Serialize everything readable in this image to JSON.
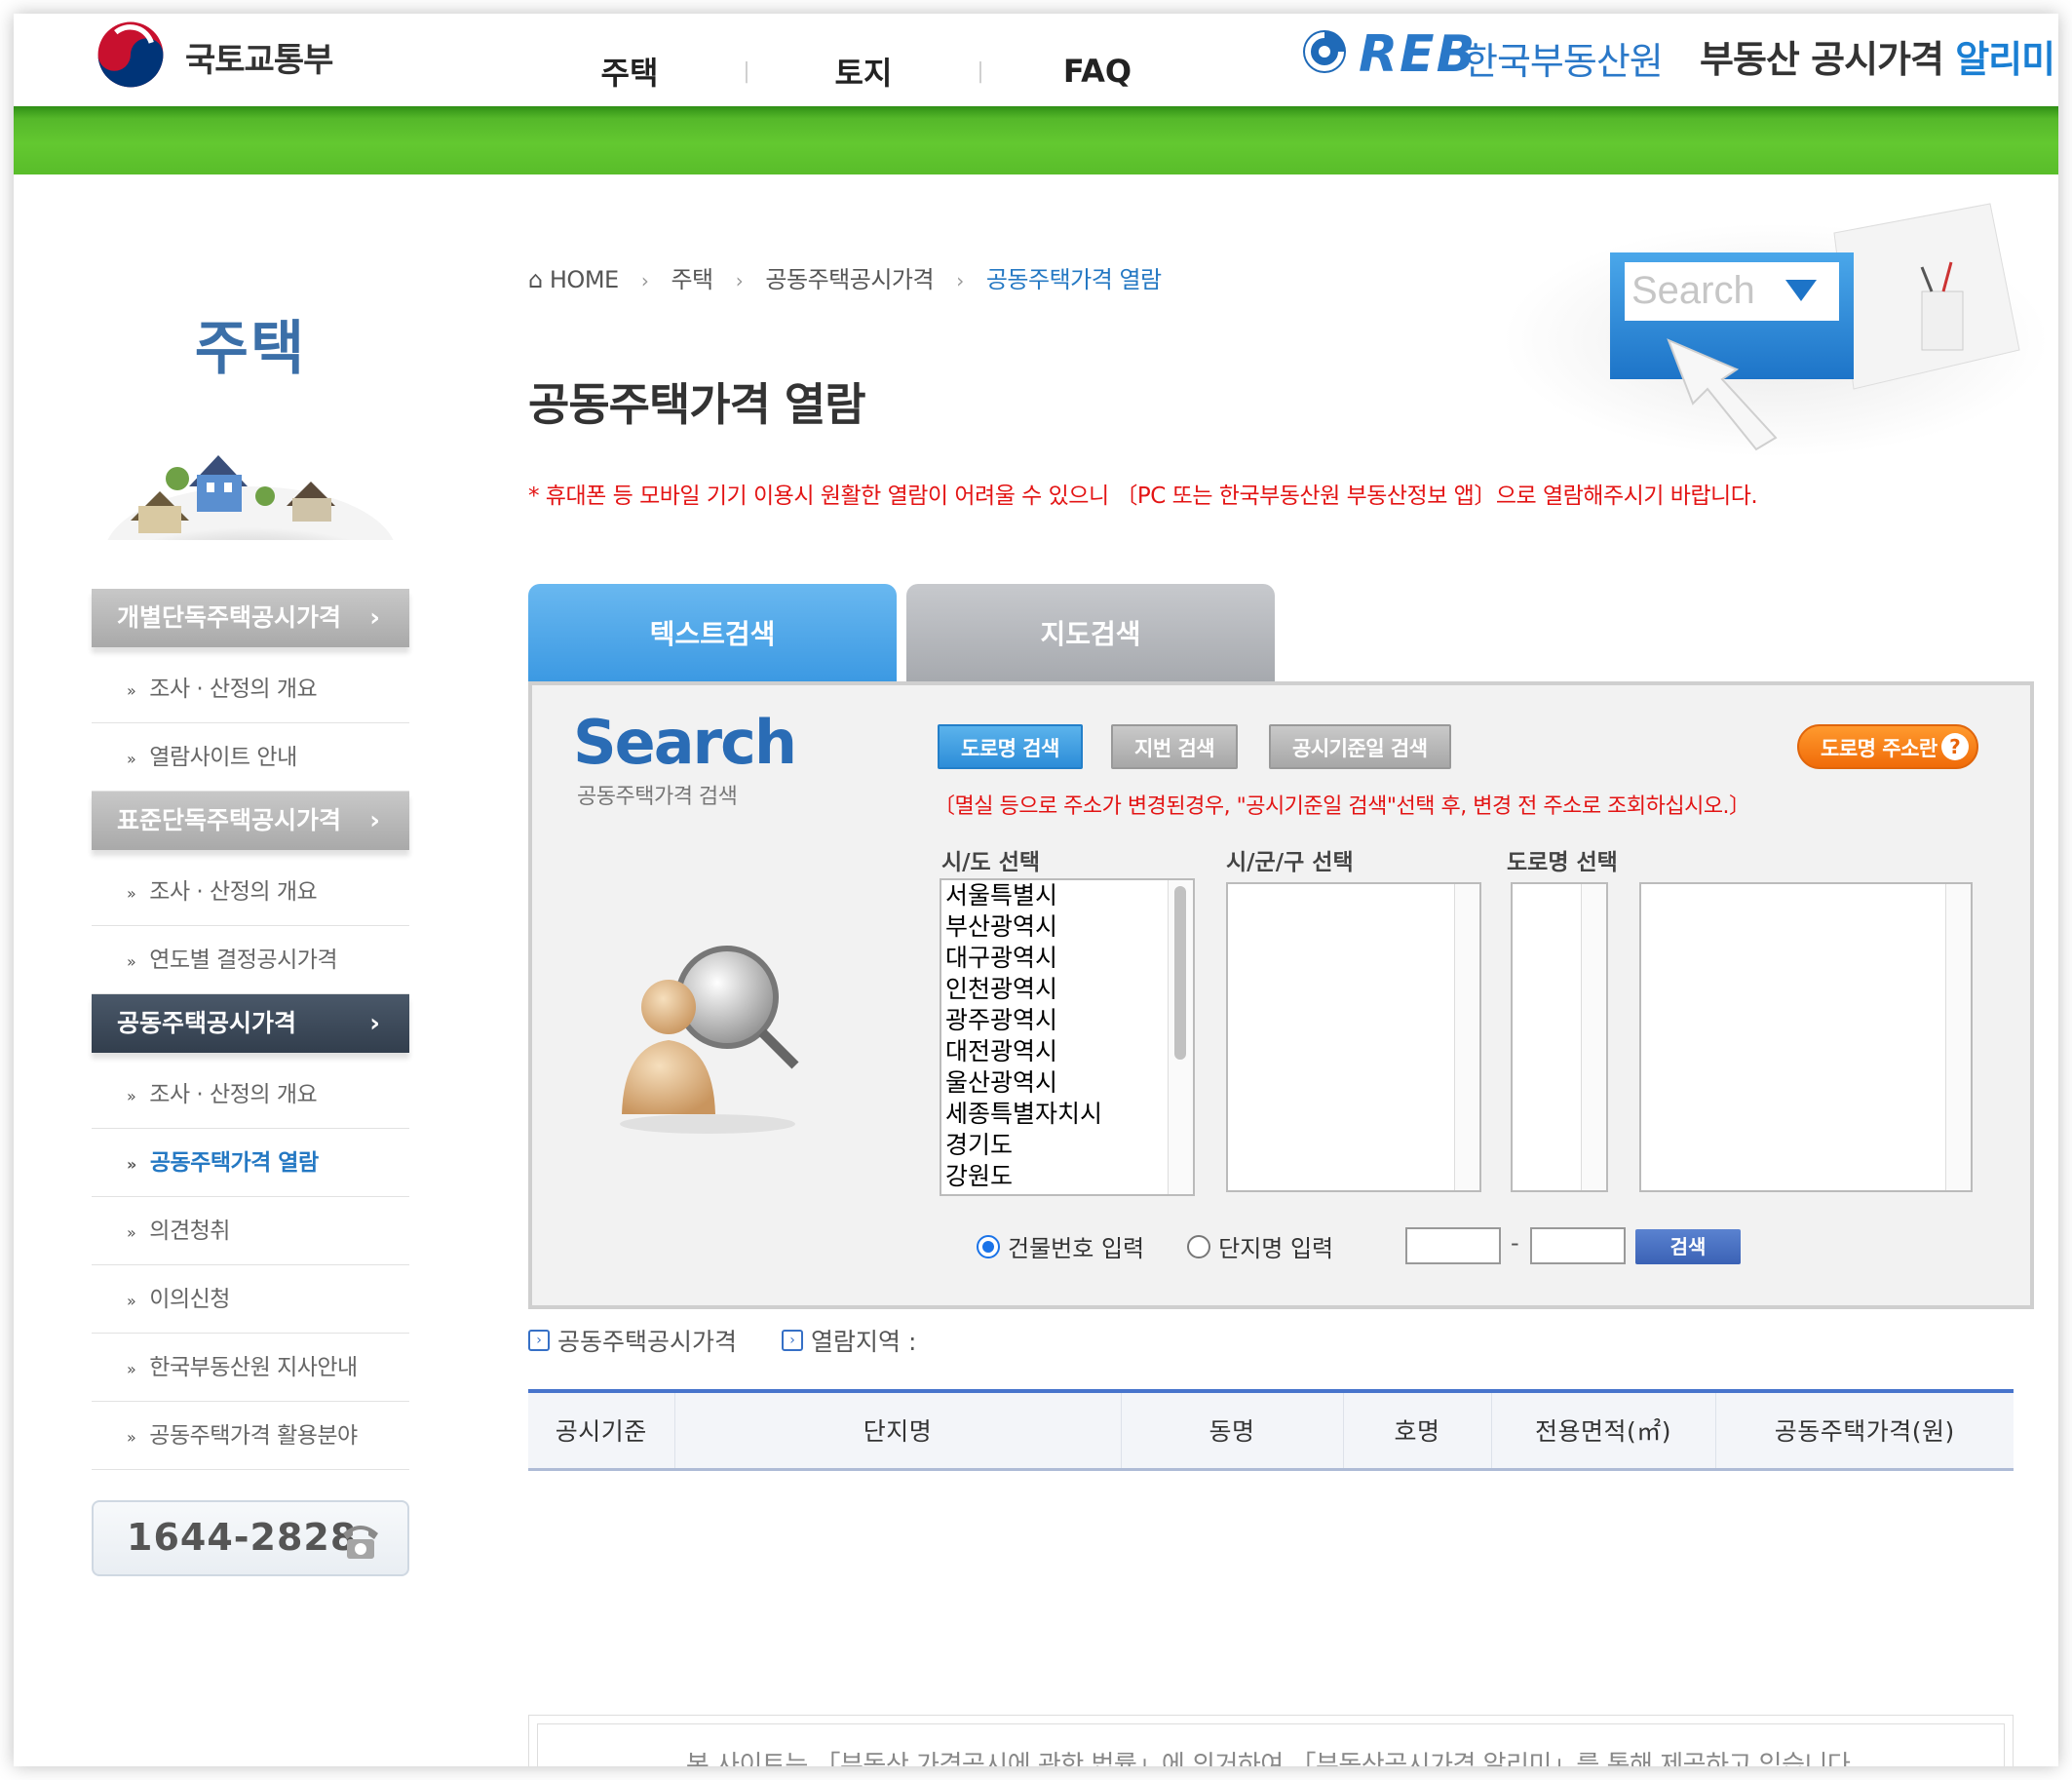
{
  "header": {
    "gov_name": "국토교통부",
    "nav": [
      "주택",
      "토지",
      "FAQ"
    ],
    "reb_logo_text": "REB",
    "reb_korean": "한국부동산원",
    "service_name": "부동산 공시가격",
    "service_highlight": "알리미"
  },
  "sidebar": {
    "title": "주택",
    "groups": [
      {
        "label": "개별단독주택공시가격",
        "items": [
          "조사 · 산정의 개요",
          "열람사이트 안내"
        ]
      },
      {
        "label": "표준단독주택공시가격",
        "items": [
          "조사 · 산정의 개요",
          "연도별 결정공시가격"
        ]
      },
      {
        "label": "공동주택공시가격",
        "active": true,
        "items": [
          "조사 · 산정의 개요",
          "공동주택가격 열람",
          "의견청취",
          "이의신청",
          "한국부동산원 지사안내",
          "공동주택가격 활용분야"
        ]
      }
    ],
    "current_item": "공동주택가격 열람",
    "phone": "1644-2828"
  },
  "breadcrumb": [
    "HOME",
    "주택",
    "공동주택공시가격",
    "공동주택가격 열람"
  ],
  "page_title": "공동주택가격 열람",
  "notice": "* 휴대폰 등 모바일 기기 이용시 원활한 열람이 어려울 수 있으니 〔PC 또는 한국부동산원 부동산정보 앱〕으로 열람해주시기 바랍니다.",
  "hero_search_word": "Search",
  "tabs": {
    "text": "텍스트검색",
    "map": "지도검색",
    "active": "텍스트검색"
  },
  "search": {
    "logo": "Search",
    "logo_sub": "공동주택가격 검색",
    "buttons": {
      "road": "도로명 검색",
      "lot": "지번 검색",
      "date": "공시기준일 검색",
      "road_info": "도로명 주소란",
      "road_info_icon": "?"
    },
    "change_note": "〔멸실 등으로 주소가 변경된경우, \"공시기준일 검색\"선택 후, 변경 전 주소로 조회하십시오.〕",
    "labels": {
      "sido": "시/도 선택",
      "sigungu": "시/군/구 선택",
      "road": "도로명 선택"
    },
    "sido_options": [
      "서울특별시",
      "부산광역시",
      "대구광역시",
      "인천광역시",
      "광주광역시",
      "대전광역시",
      "울산광역시",
      "세종특별자치시",
      "경기도",
      "강원도"
    ],
    "radio": {
      "building": "건물번호 입력",
      "complex": "단지명 입력",
      "selected": "건물번호 입력"
    },
    "dash": "-",
    "submit": "검색",
    "input_values": [
      "",
      ""
    ]
  },
  "result": {
    "meta": {
      "category": "공동주택공시가격",
      "region_label": "열람지역 :"
    },
    "columns": [
      "공시기준",
      "단지명",
      "동명",
      "호명",
      "전용면적(㎡)",
      "공동주택가격(원)"
    ]
  },
  "footer": "본 사이트는 「부동산 가격공시에 관한 법률」에 의거하여 「부동산공시가격 알리미」를 통해 제공하고 있습니다.",
  "colors": {
    "green": "#5fc42e",
    "blue": "#2478c3",
    "red": "#e31414",
    "orange": "#f07a12"
  },
  "icons": [
    "home-icon",
    "taegeuk-logo-icon",
    "reb-logo-icon",
    "phone-icon",
    "question-icon",
    "magnifier-person-icon",
    "houses-icon"
  ]
}
